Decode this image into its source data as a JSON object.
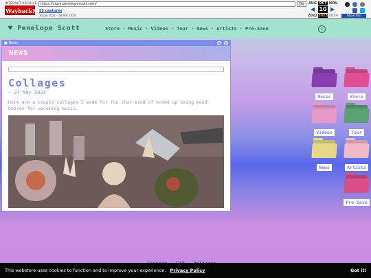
{
  "wayback": {
    "ia_text": "INTERNET ARCHIVE",
    "logo_text": "WaybackMachine",
    "url": "https://store.penelopescott.com/",
    "go_label": "Go",
    "captures": "52 captures",
    "date_range": "20 Jan 2021 - 18 Mar 2024",
    "months": [
      "AUG",
      "OCT",
      "NOV"
    ],
    "day": "10",
    "years": [
      "2022",
      "2023",
      "2024"
    ],
    "about_label": "About this capture"
  },
  "header": {
    "brand": "Penelope Scott",
    "nav": [
      "Store",
      "Music",
      "Videos",
      "Tour",
      "News",
      "Artists",
      "Pre-Save"
    ]
  },
  "news_window": {
    "title": "News",
    "banner": "NEWS",
    "post_title": "Collages",
    "post_date": "- 27 May 2023",
    "post_text": "Here are a couple collages I made for fun that kind of ended up being mood boards for upcoming music."
  },
  "folders": [
    {
      "label": "Music",
      "color": "#8a3fb0"
    },
    {
      "label": "Store",
      "color": "#e04f93"
    },
    {
      "label": "Videos",
      "color": "#e69ac6"
    },
    {
      "label": "Tour",
      "color": "#5aa276"
    },
    {
      "label": "News",
      "color": "#e6d98c"
    },
    {
      "label": "Artists",
      "color": "#f0b9c6"
    },
    {
      "label": "Pre-Save",
      "color": "#d94f86"
    }
  ],
  "footer_links": "Contact · FAQ · Policies",
  "cookie": {
    "message": "This webstore uses cookies to function and to improve your experience.",
    "link": "Privacy Policy",
    "ok": "Got it!"
  }
}
